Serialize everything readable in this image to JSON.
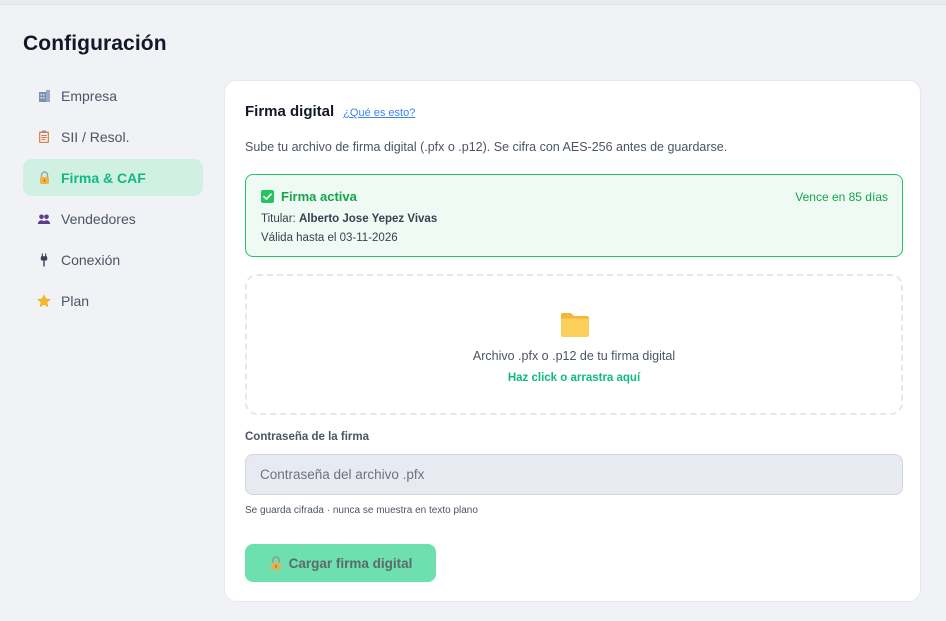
{
  "page": {
    "title": "Configuración"
  },
  "sidebar": {
    "items": [
      {
        "label": "Empresa",
        "icon": "building-icon",
        "active": false
      },
      {
        "label": "SII / Resol.",
        "icon": "clipboard-icon",
        "active": false
      },
      {
        "label": "Firma & CAF",
        "icon": "lock-icon",
        "active": true
      },
      {
        "label": "Vendedores",
        "icon": "users-icon",
        "active": false
      },
      {
        "label": "Conexión",
        "icon": "plug-icon",
        "active": false
      },
      {
        "label": "Plan",
        "icon": "star-icon",
        "active": false
      }
    ]
  },
  "card": {
    "title": "Firma digital",
    "help_link": "¿Qué es esto?",
    "description": "Sube tu archivo de firma digital (.pfx o .p12). Se cifra con AES-256 antes de guardarse.",
    "status": {
      "title": "Firma activa",
      "expiry": "Vence en 85 días",
      "holder_label": "Titular:",
      "holder_name": "Alberto Jose Yepez Vivas",
      "valid_until": "Válida hasta el 03-11-2026"
    },
    "dropzone": {
      "text": "Archivo .pfx o .p12 de tu firma digital",
      "link": "Haz click o arrastra aquí"
    },
    "password": {
      "label": "Contraseña de la firma",
      "placeholder": "Contraseña del archivo .pfx",
      "value": "",
      "hint": "Se guarda cifrada · nunca se muestra en texto plano"
    },
    "submit_label": "Cargar firma digital"
  },
  "colors": {
    "accent": "#10b981",
    "accent_bg": "#d1f0e4",
    "success_border": "#22c55e",
    "success_bg": "#eefaf3",
    "button_bg": "#6ee0b0",
    "link": "#3b82f6",
    "page_bg": "#f1f2f6"
  }
}
